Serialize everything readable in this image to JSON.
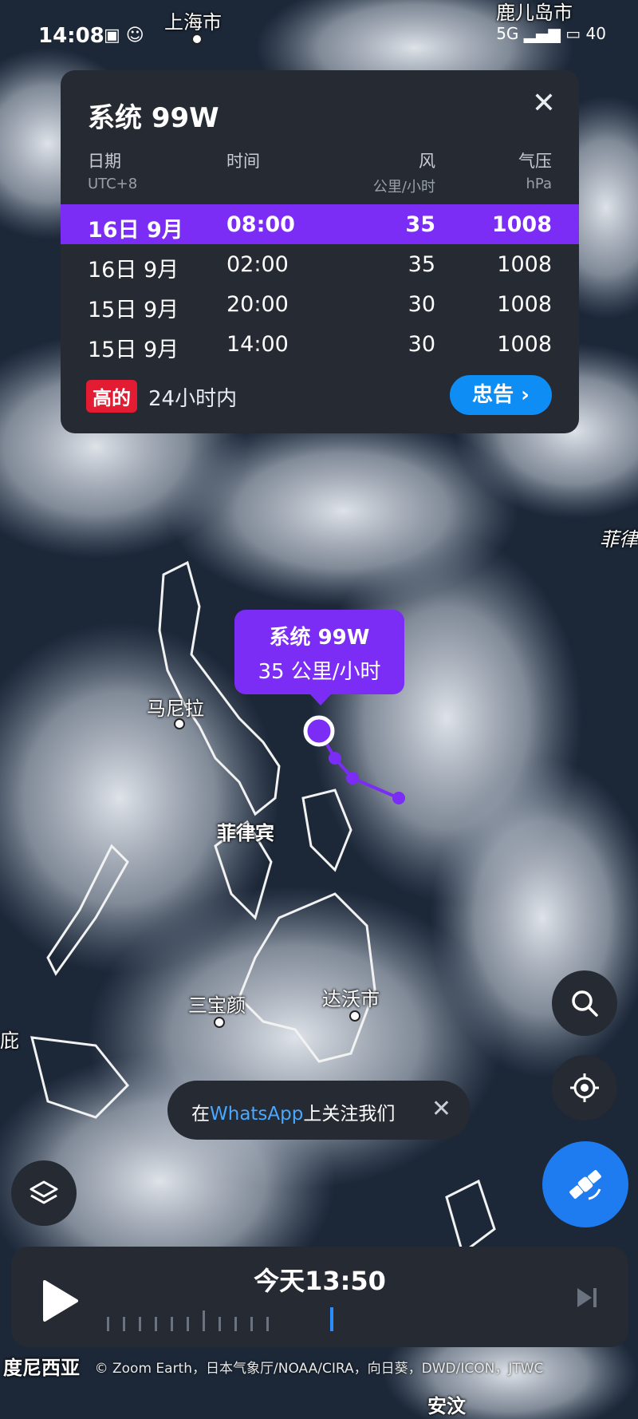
{
  "status_bar": {
    "time": "14:08",
    "network": "5G",
    "battery": "40"
  },
  "places": {
    "shanghai": "上海市",
    "kagoshima": "鹿儿岛市",
    "philippines_sea": "菲律",
    "manila": "马尼拉",
    "philippines": "菲律宾",
    "sanbaoyan": "三宝颜",
    "davao": "达沃市",
    "indonesia": "度尼西亚",
    "left_edge": "庇",
    "andong": "安汶"
  },
  "panel": {
    "title": "系统 99W",
    "headers": {
      "date": "日期",
      "date_sub": "UTC+8",
      "time": "时间",
      "wind": "风",
      "wind_sub": "公里/小时",
      "pressure": "气压",
      "pressure_sub": "hPa"
    },
    "rows": [
      {
        "date": "16日 9月",
        "time": "08:00",
        "wind": "35",
        "pressure": "1008"
      },
      {
        "date": "16日 9月",
        "time": "02:00",
        "wind": "35",
        "pressure": "1008"
      },
      {
        "date": "15日 9月",
        "time": "20:00",
        "wind": "30",
        "pressure": "1008"
      },
      {
        "date": "15日 9月",
        "time": "14:00",
        "wind": "30",
        "pressure": "1008"
      }
    ],
    "risk_badge": "高的",
    "risk_text": "24小时内",
    "warning_button": "忠告"
  },
  "storm_label": {
    "name": "系统 99W",
    "speed": "35 公里/小时"
  },
  "toast": {
    "prefix": "在",
    "brand": "WhatsApp",
    "suffix": "上关注我们"
  },
  "timeline": {
    "current": "今天13:50"
  },
  "credit": "© Zoom Earth，日本气象厅/NOAA/CIRA，向日葵，DWD/ICON，JTWC",
  "colors": {
    "accent_purple": "#7b2cf5",
    "accent_blue": "#0e8df5",
    "badge_red": "#e31b33",
    "panel_bg": "#262a33"
  }
}
